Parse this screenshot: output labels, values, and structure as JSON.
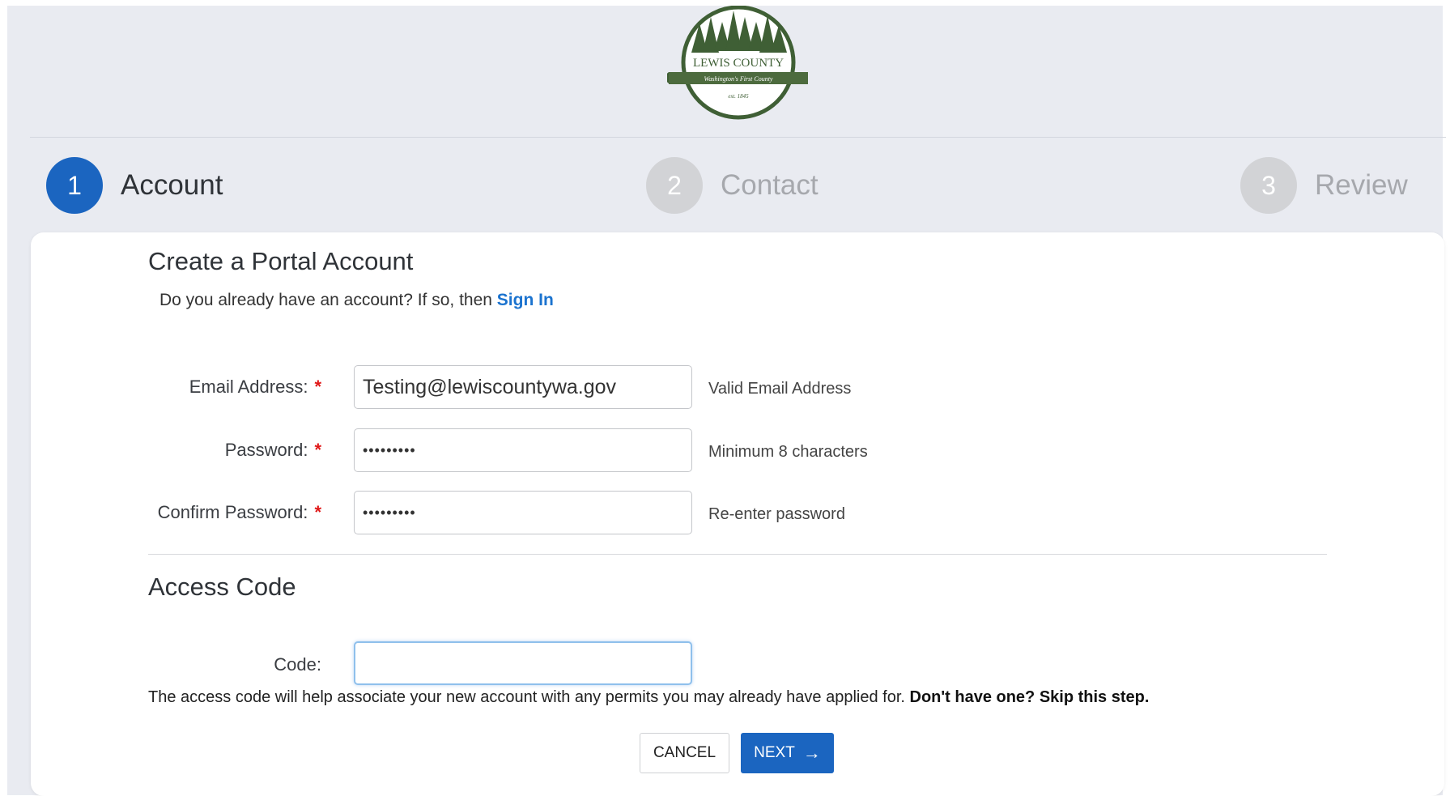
{
  "logo": {
    "name": "LEWIS COUNTY",
    "tagline": "Washington's First County",
    "est": "est. 1845"
  },
  "stepper": {
    "steps": [
      {
        "number": "1",
        "label": "Account",
        "state": "active"
      },
      {
        "number": "2",
        "label": "Contact",
        "state": "inactive"
      },
      {
        "number": "3",
        "label": "Review",
        "state": "inactive"
      }
    ]
  },
  "account": {
    "title": "Create a Portal Account",
    "signin_prompt": "Do you already have an account? If so, then",
    "signin_link": "Sign In",
    "fields": {
      "email": {
        "label": "Email Address:",
        "value": "Testing@lewiscountywa.gov",
        "hint": "Valid Email Address"
      },
      "password": {
        "label": "Password:",
        "value": "•••••••••",
        "hint": "Minimum 8 characters"
      },
      "confirm": {
        "label": "Confirm Password:",
        "value": "•••••••••",
        "hint": "Re-enter password"
      }
    },
    "required_mark": "*"
  },
  "access_code": {
    "title": "Access Code",
    "label": "Code:",
    "value": "",
    "note": "The access code will help associate your new account with any permits you may already have applied for.",
    "note_bold": "Don't have one? Skip this step."
  },
  "buttons": {
    "cancel": "CANCEL",
    "next": "NEXT",
    "next_arrow": "→"
  },
  "colors": {
    "primary": "#1b65c0",
    "link": "#1b73cf",
    "required": "#e01818",
    "logo_green": "#3f5f35",
    "background": "#e9ebf1"
  }
}
